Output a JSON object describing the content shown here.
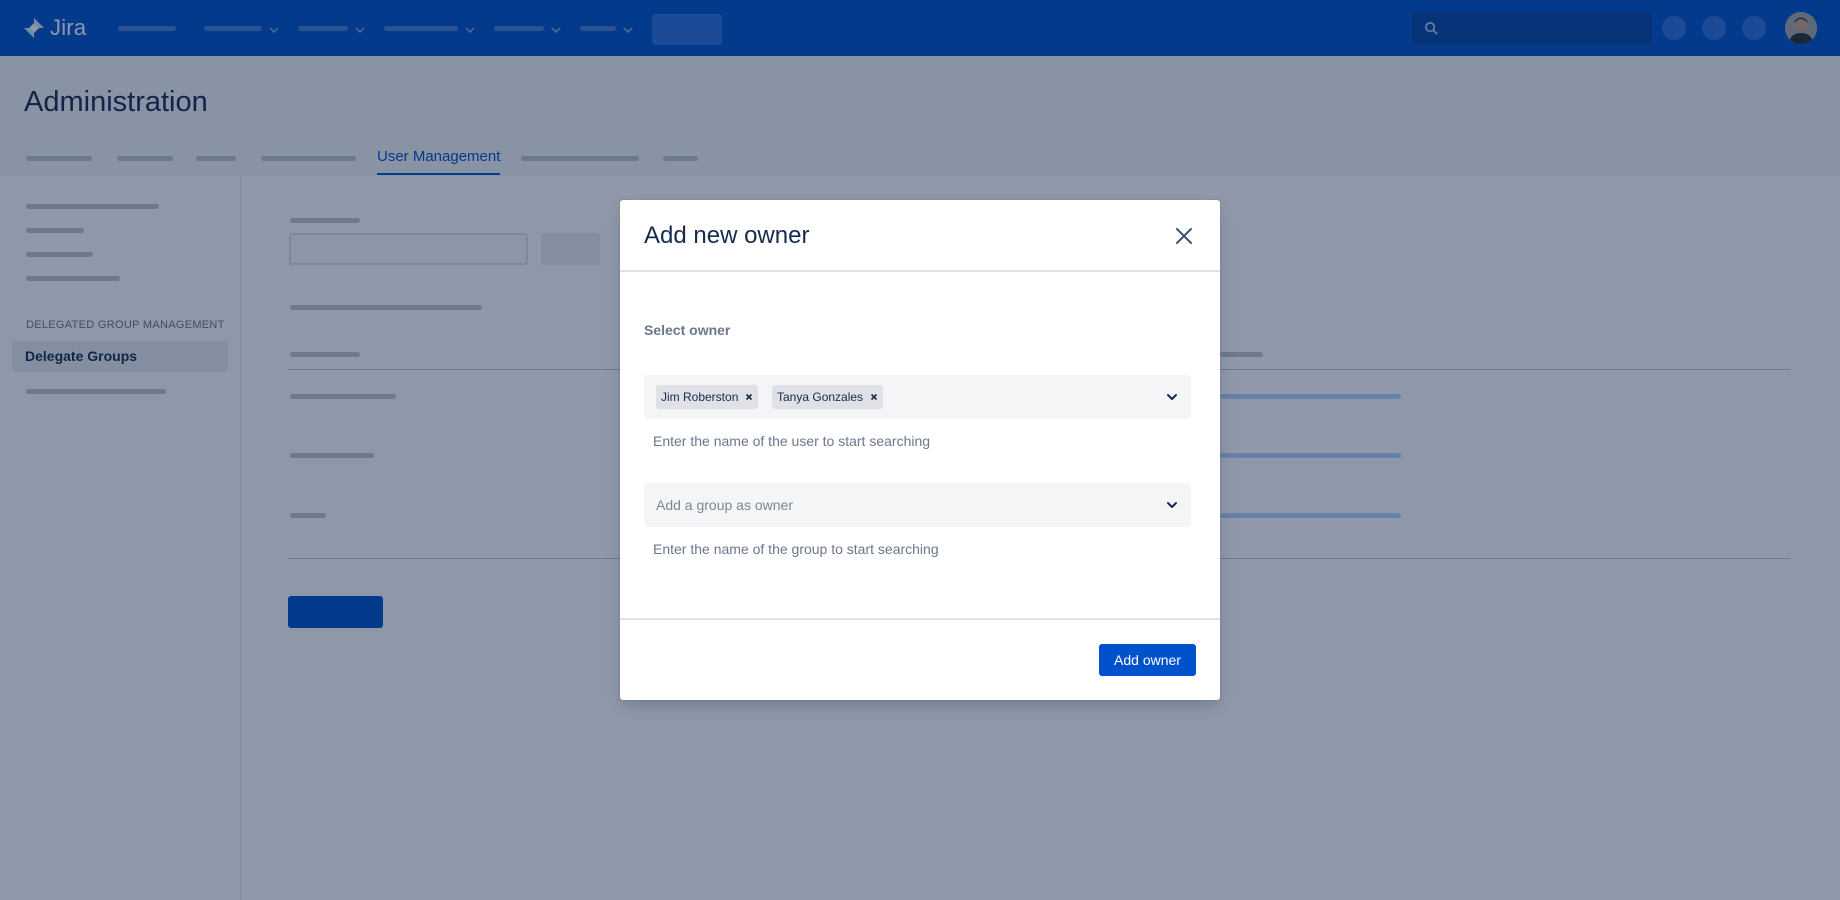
{
  "header": {
    "logo_text": "Jira",
    "colors": {
      "nav_bg": "#0052cc",
      "accent": "#0052cc"
    }
  },
  "page": {
    "title": "Administration",
    "active_tab": "User Management"
  },
  "sidebar": {
    "section_heading": "DELEGATED GROUP MANAGEMENT",
    "active_item": "Delegate Groups"
  },
  "modal": {
    "title": "Add new owner",
    "close_icon": "close-icon",
    "select_label": "Select owner",
    "selected_users": [
      {
        "name": "Jim Roberston"
      },
      {
        "name": "Tanya Gonzales"
      }
    ],
    "user_helper": "Enter the name of the user to start searching",
    "group_placeholder": "Add a group as owner",
    "group_helper": "Enter the name of the group to start searching",
    "submit_label": "Add owner"
  }
}
